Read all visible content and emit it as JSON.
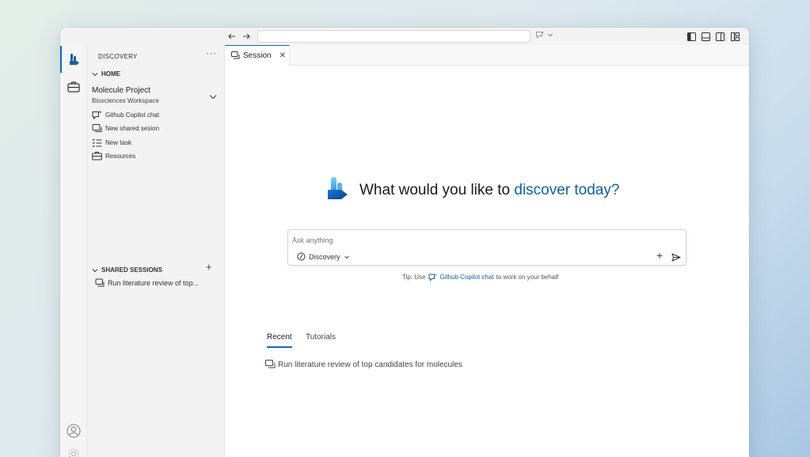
{
  "titlebar": {
    "url": "",
    "back_icon": "arrow-left-icon",
    "forward_icon": "arrow-right-icon"
  },
  "activity": {
    "items": [
      "discovery-logo-icon",
      "briefcase-icon"
    ],
    "bottom": [
      "account-icon",
      "settings-icon"
    ]
  },
  "sidebar": {
    "title": "DISCOVERY",
    "more": "···",
    "home_label": "HOME",
    "project_name": "Molecule Project",
    "project_workspace": "Biosciences Workspace",
    "items": [
      {
        "label": "Github Copilot chat",
        "icon": "copilot-chat-icon"
      },
      {
        "label": "New shared sesion",
        "icon": "shared-session-icon"
      },
      {
        "label": "New task",
        "icon": "task-list-icon"
      },
      {
        "label": "Resources",
        "icon": "briefcase-icon"
      }
    ],
    "shared_label": "SHARED SESSIONS",
    "shared_add": "+",
    "shared_items": [
      {
        "label": "Run literature review of top..."
      }
    ]
  },
  "tab": {
    "label": "Session",
    "close": "✕"
  },
  "hero": {
    "prefix": "What would you like to ",
    "accent": "discover today?"
  },
  "prompt": {
    "placeholder": "Ask anything",
    "mode": "Discovery",
    "add": "+"
  },
  "tip": {
    "prefix": "Tip: Use",
    "link": "Github Copilot chat",
    "suffix": "to work on your behalf"
  },
  "recent_tabs": [
    {
      "label": "Recent",
      "active": true
    },
    {
      "label": "Tutorials",
      "active": false
    }
  ],
  "recent_items": [
    {
      "label": "Run literature review of top candidates for molecules"
    }
  ],
  "colors": {
    "accent": "#0f6cbd",
    "link": "#0f5fa8"
  }
}
